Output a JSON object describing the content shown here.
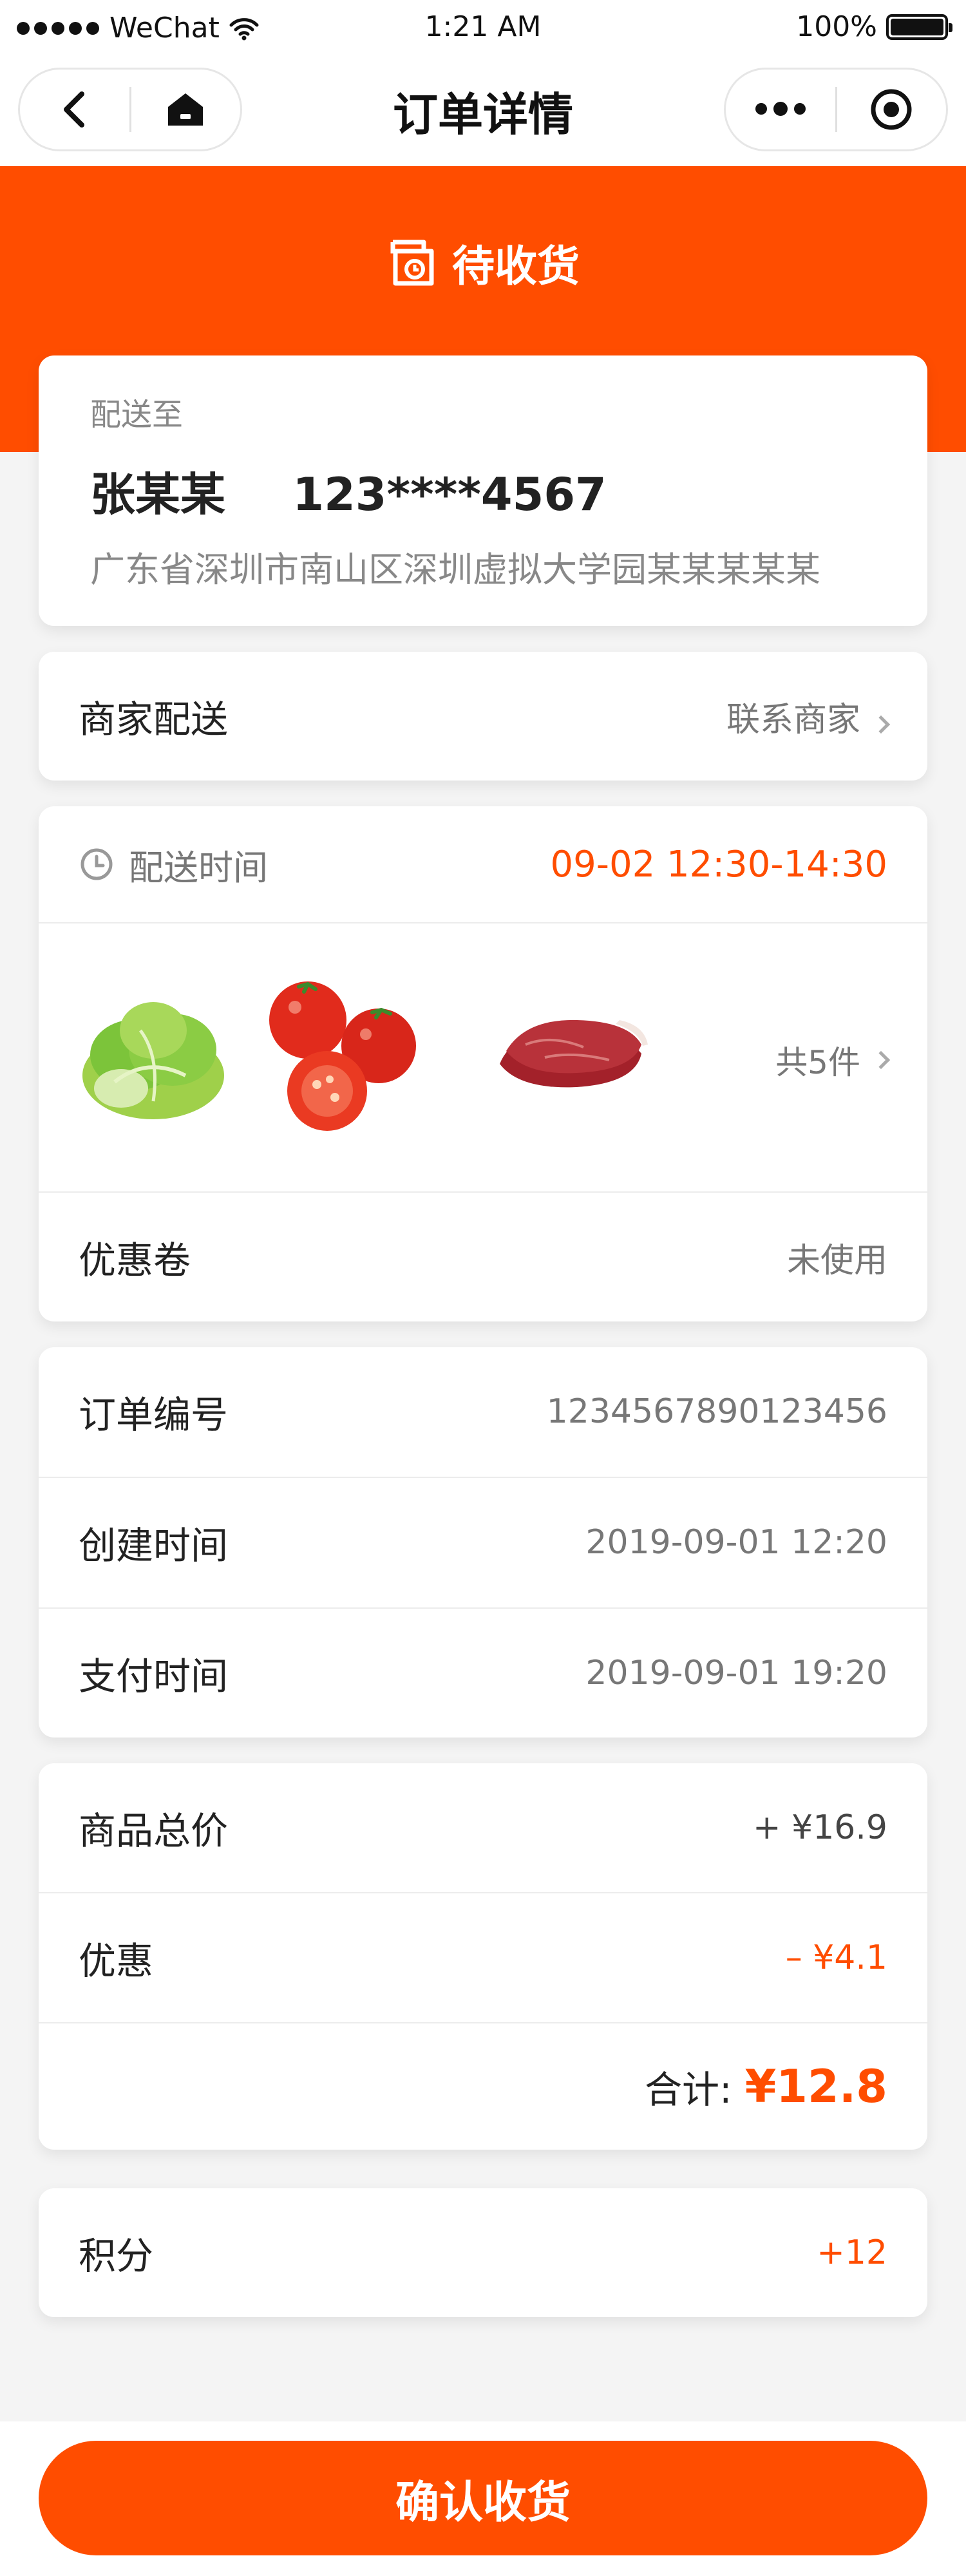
{
  "status_bar": {
    "carrier": "WeChat",
    "time": "1:21 AM",
    "battery": "100%"
  },
  "nav": {
    "title": "订单详情",
    "back_icon": "chevron-left-icon",
    "home_icon": "home-icon",
    "more_icon": "more-dots-icon",
    "close_icon": "target-circle-icon"
  },
  "order_status": {
    "icon": "delivery-status-icon",
    "label": "待收货"
  },
  "address": {
    "heading": "配送至",
    "name": "张某某",
    "phone": "123****4567",
    "detail": "广东省深圳市南山区深圳虚拟大学园某某某某某"
  },
  "merchant": {
    "label": "商家配送",
    "action": "联系商家"
  },
  "delivery": {
    "label": "配送时间",
    "time": "09-02 12:30-14:30",
    "items": [
      "lettuce",
      "tomatoes",
      "beef-steak"
    ],
    "count_label": "共5件"
  },
  "coupon": {
    "label": "优惠卷",
    "value": "未使用"
  },
  "order_info": [
    {
      "label": "订单编号",
      "value": "1234567890123456"
    },
    {
      "label": "创建时间",
      "value": "2019-09-01 12:20"
    },
    {
      "label": "支付时间",
      "value": "2019-09-01 19:20"
    }
  ],
  "price": {
    "goods_label": "商品总价",
    "goods_value": "+ ¥16.9",
    "discount_label": "优惠",
    "discount_value": "– ¥4.1",
    "total_label": "合计:",
    "total_value": "¥12.8"
  },
  "points": {
    "label": "积分",
    "value": "+12"
  },
  "confirm_button": "确认收货",
  "colors": {
    "accent": "#ff4d00",
    "background": "#f4f4f4"
  }
}
